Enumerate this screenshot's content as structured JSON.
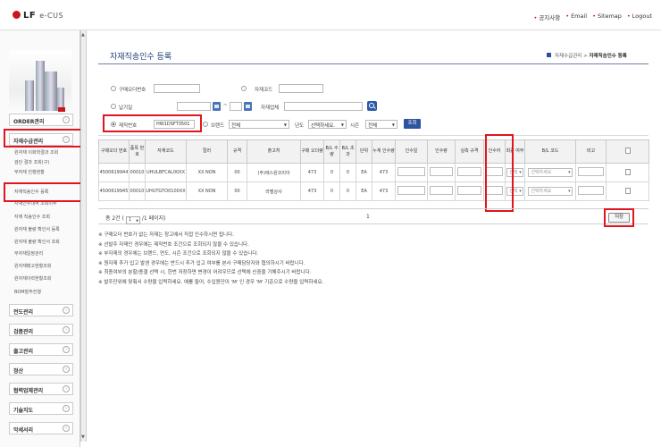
{
  "header": {
    "logo_main": "LF",
    "logo_sub": "e-CUS",
    "links": [
      "공지사항",
      "Email",
      "Sitemap",
      "Logout"
    ]
  },
  "sidebar": {
    "menus": [
      {
        "label": "ORDER관리",
        "arrow": "›"
      },
      {
        "label": "자재수급관리",
        "arrow": "›"
      },
      {
        "label": "전도관리",
        "arrow": "›"
      },
      {
        "label": "검품관리",
        "arrow": "›"
      },
      {
        "label": "출고관리",
        "arrow": "›"
      },
      {
        "label": "정산",
        "arrow": "›"
      },
      {
        "label": "협력업체관리",
        "arrow": "›"
      },
      {
        "label": "기술지도",
        "arrow": "›"
      },
      {
        "label": "악세서리",
        "arrow": "›"
      }
    ],
    "sub_items": [
      "원자재 이화학결과 조회",
      "검단 결과 조회(구)",
      "부자재 진행현황",
      "자재직송인수 등록",
      "자재인수내역 조회이주",
      "자재 직송인수 조회",
      "원자재 불량 확인서 등록",
      "원자재 불량 확인서 조회",
      "부자재일정관리",
      "원자재매고현황조회",
      "원자재이력현황조회",
      "BOM발주진행"
    ]
  },
  "page": {
    "title": "자재직송인수 등록",
    "breadcrumb_parent": "자재수급관리 >",
    "breadcrumb_current": "자재직송인수 등록"
  },
  "filters": {
    "po_label": "구매오더번호",
    "material_code_label": "자재코드",
    "delivery_date_label": "납기일",
    "date_sep": "~",
    "vendor_label": "자재업체",
    "product_no_label": "제직번호",
    "product_no_value": "HW1DSFT3501",
    "brand_label": "브랜드",
    "brand_value": "전체",
    "year_label": "년도",
    "year_value": "선택하세요.",
    "season_label": "시즌",
    "season_value": "전체",
    "query_button": "조회"
  },
  "table": {
    "headers": [
      "구매오더 번호",
      "품목 번호",
      "자재코드",
      "컬러",
      "규격",
      "출고처",
      "구매 오더량",
      "B/L 수량",
      "B/L 초과",
      "단위",
      "누계 인수량",
      "인수일",
      "인수량",
      "실측 규격",
      "인수자",
      "최종 여부",
      "B/L 코드",
      "비고",
      ""
    ],
    "rows": [
      {
        "po": "4500619944",
        "item": "00010",
        "code": "UHULBFCAL00XX",
        "color": "XX NON",
        "spec": "00",
        "vendor": "(주)에스원코리아",
        "qty": "473",
        "bl_qty": "0",
        "bl_over": "0",
        "unit": "EA",
        "cum": "473",
        "final": "선택",
        "bl_code": "선택하세요"
      },
      {
        "po": "4500619945",
        "item": "00010",
        "code": "UHUTGTO0100XX",
        "color": "XX NON",
        "spec": "00",
        "vendor": "라벨상사",
        "qty": "473",
        "bl_qty": "0",
        "bl_over": "0",
        "unit": "EA",
        "cum": "473",
        "final": "선택",
        "bl_code": "선택하세요"
      }
    ]
  },
  "pager": {
    "total_prefix": "총 2건 (",
    "page_select": "1",
    "total_suffix": "/1 페이지)",
    "page_number": "1",
    "save_button": "저장"
  },
  "notes": [
    "※ 구매오더 번호가 없는 자재는 창고에서 직접 인수하시면 됩니다.",
    "※ 선발주 자재인 경우에는 제직번호 조건으로 조회되지 않을 수 있습니다.",
    "※ 부자재의 경우에는 브랜드, 연도, 시즌 조건으로 조회되지 않을 수 있습니다.",
    "※ 원자재 추가 입고 발생 경우에는 반드시 추가 입고 여부를 본사 구매담당자와 협의하시기 바랍니다.",
    "※ 최종여부의 분할/종결 선택 시, 한번 저장하면 변경이 어려우므로 선택에 신중을 기해주시기 바랍니다.",
    "※ 발주단위에 맞춰서 수량을 입력하세요. 예를 들어, 수입원단이 'M' 인 경우 'M' 기준으로 수량을 입력하세요."
  ]
}
